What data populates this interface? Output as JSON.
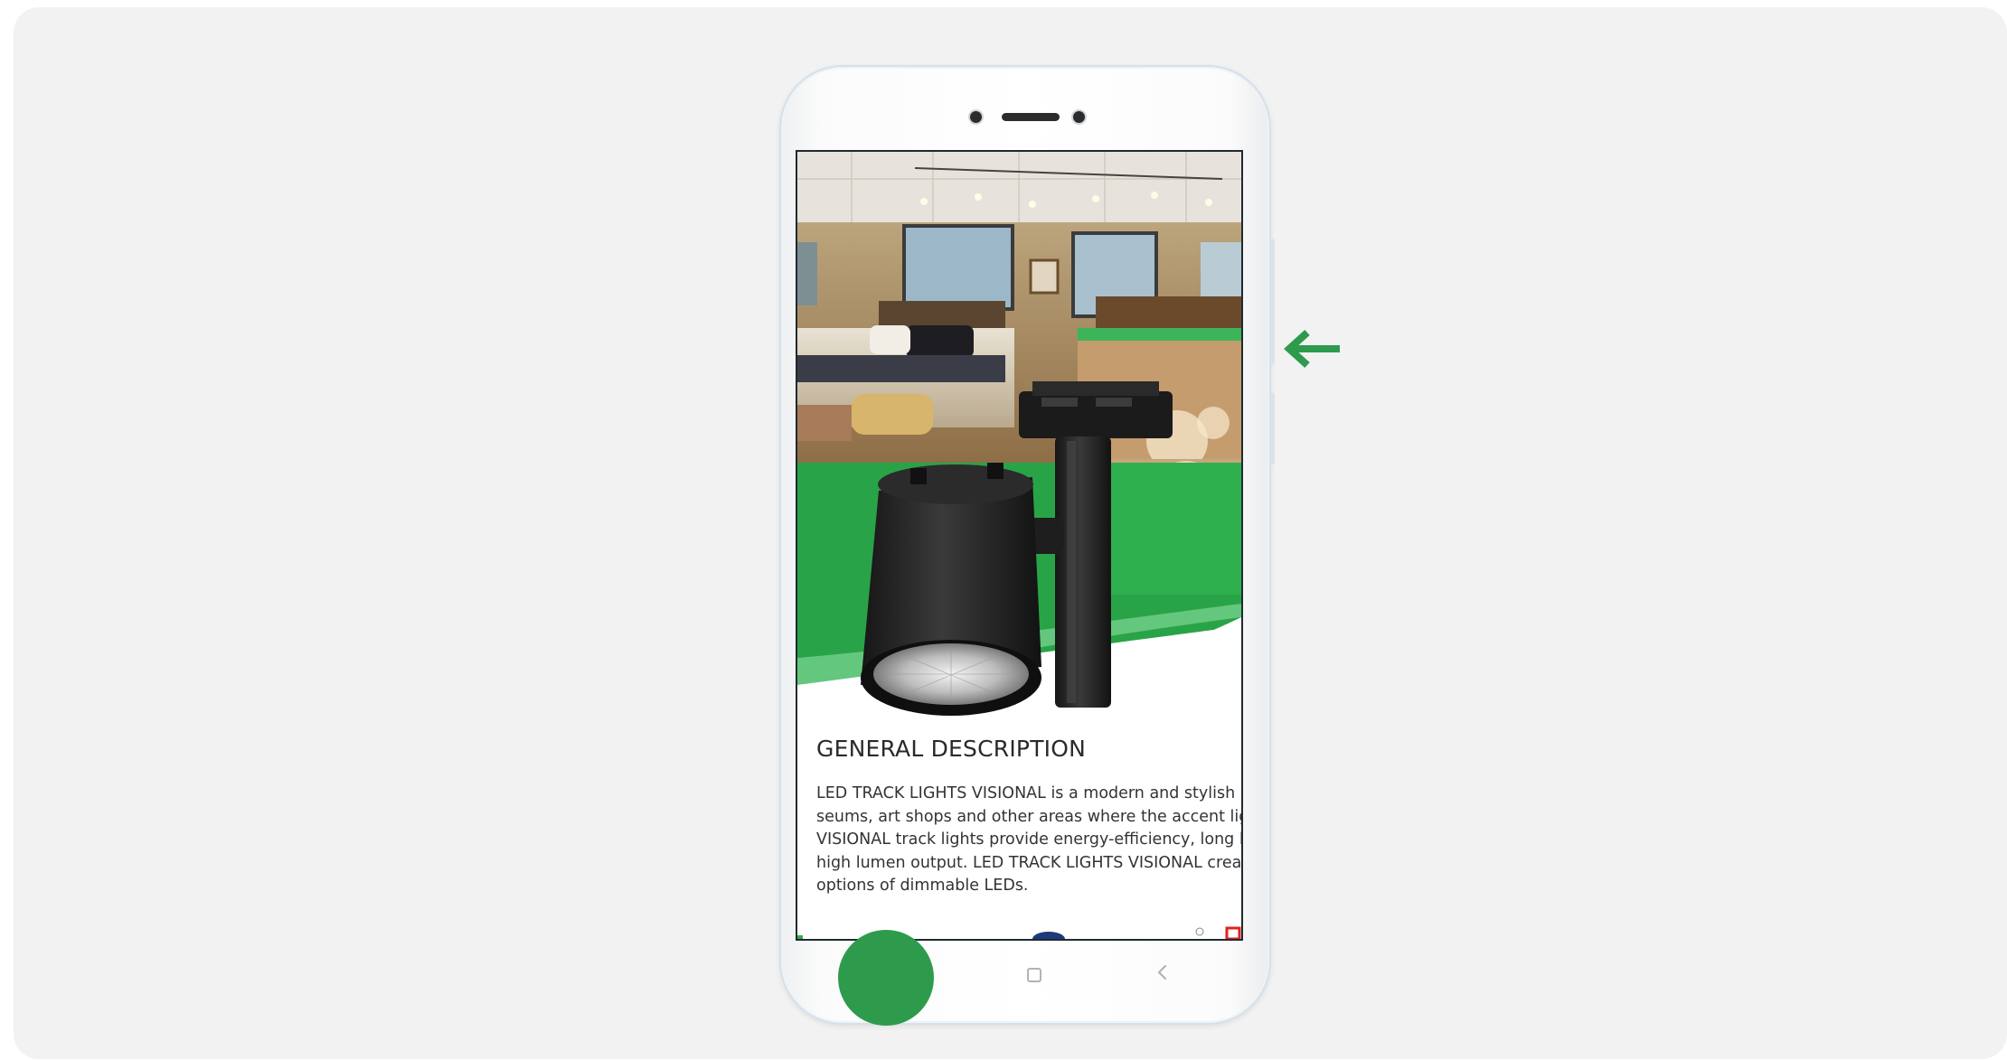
{
  "app": {
    "accent_color": "#2e9b4c"
  },
  "screen": {
    "product_image": {
      "icon": "track-light-product-icon",
      "background": "showroom-photo"
    },
    "general_description": {
      "title": "GENERAL DESCRIPTION",
      "lines": [
        "LED TRACK LIGHTS VISIONAL is a modern and stylish li",
        "seums, art shops and other areas where the accent lig",
        "VISIONAL track lights provide energy-efficiency, long li",
        "high lumen output. LED TRACK LIGHTS VISIONAL creat",
        "options of dimmable LEDs."
      ]
    }
  },
  "device": {
    "nav": {
      "home_icon": "square-home-icon",
      "back_icon": "chevron-left-back-icon"
    }
  },
  "overlays": {
    "swipe_arrow_icon": "arrow-left-icon",
    "tap_indicator_color": "#2e9b4c"
  }
}
